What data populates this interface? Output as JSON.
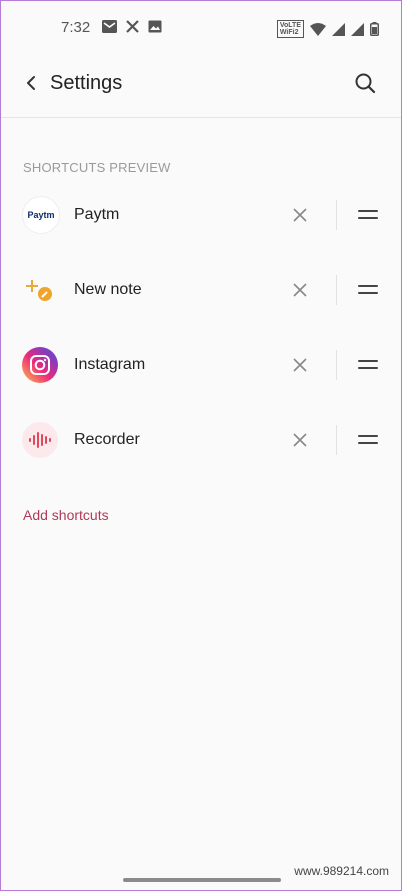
{
  "status": {
    "time": "7:32",
    "volte_line1": "VoLTE",
    "volte_line2": "WiFi2"
  },
  "appbar": {
    "title": "Settings"
  },
  "section": {
    "header": "SHORTCUTS PREVIEW"
  },
  "shortcuts": [
    {
      "label": "Paytm",
      "icon": "paytm-icon",
      "icon_text": "Paytm"
    },
    {
      "label": "New note",
      "icon": "new-note-icon"
    },
    {
      "label": "Instagram",
      "icon": "instagram-icon"
    },
    {
      "label": "Recorder",
      "icon": "recorder-icon"
    }
  ],
  "add_shortcuts": "Add shortcuts",
  "watermark": "www.989214.com",
  "colors": {
    "accent": "#b03a5a",
    "background": "#fafafa",
    "border": "#b57bd6"
  }
}
